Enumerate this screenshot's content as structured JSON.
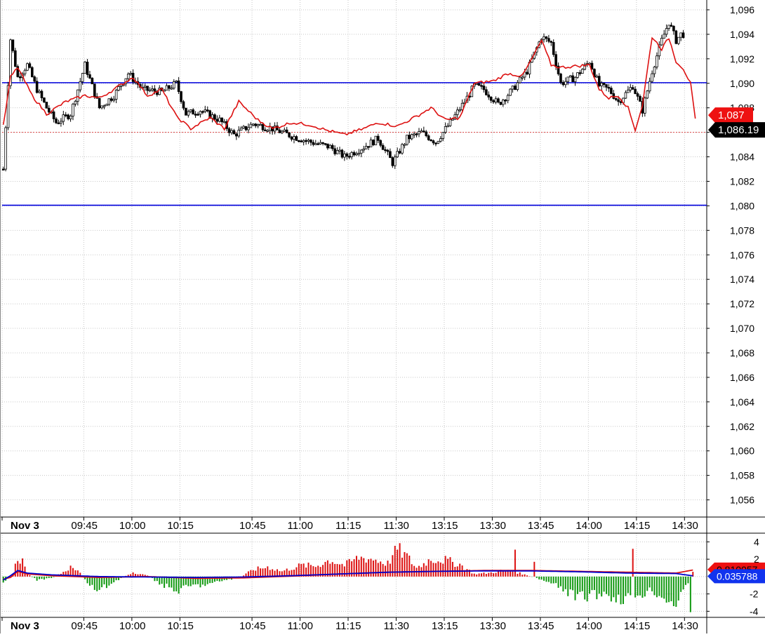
{
  "chart_data": [
    {
      "type": "candlestick",
      "panel": "price",
      "title": "",
      "y_axis_side": "right",
      "ylim": [
        1054.6,
        1096.8
      ],
      "y_ticks": [
        "1,096",
        "1,094",
        "1,092",
        "1,090",
        "1,088",
        "1,086",
        "1,084",
        "1,082",
        "1,080",
        "1,078",
        "1,076",
        "1,074",
        "1,072",
        "1,070",
        "1,068",
        "1,066",
        "1,064",
        "1,062",
        "1,060",
        "1,058",
        "1,056"
      ],
      "y_tick_values": [
        1096,
        1094,
        1092,
        1090,
        1088,
        1086,
        1084,
        1082,
        1080,
        1078,
        1076,
        1074,
        1072,
        1070,
        1068,
        1066,
        1064,
        1062,
        1060,
        1058,
        1056
      ],
      "x_ticks": [
        "Nov 3",
        "09:45",
        "10:00",
        "10:15",
        "10:45",
        "11:00",
        "11:15",
        "11:30",
        "13:15",
        "13:30",
        "13:45",
        "14:00",
        "14:15",
        "14:30"
      ],
      "x_tick_slots": [
        0,
        34,
        54,
        74,
        104,
        124,
        144,
        164,
        184,
        204,
        224,
        244,
        264,
        284
      ],
      "n_slots": 288,
      "grid": true,
      "horizontal_lines": [
        {
          "value": 1090.05,
          "color": "#0000dd"
        },
        {
          "value": 1080.05,
          "color": "#0000dd"
        },
        {
          "value": 1086.0,
          "color": "#dd4444",
          "style": "dotted"
        }
      ],
      "price_labels": [
        {
          "text": "1,087",
          "value": 1087.4,
          "bg": "#ee1111",
          "fg": "#ffffff"
        },
        {
          "text": "1,086.19",
          "value": 1086.2,
          "bg": "#000000",
          "fg": "#ffffff"
        }
      ],
      "close_anchors": [
        [
          0,
          1083
        ],
        [
          3,
          1093.6
        ],
        [
          6,
          1090.5
        ],
        [
          10,
          1091.5
        ],
        [
          14,
          1089.5
        ],
        [
          18,
          1088
        ],
        [
          22,
          1086.8
        ],
        [
          28,
          1087.5
        ],
        [
          34,
          1091.5
        ],
        [
          40,
          1088
        ],
        [
          46,
          1089
        ],
        [
          52,
          1090.8
        ],
        [
          58,
          1089.5
        ],
        [
          66,
          1089.3
        ],
        [
          72,
          1090
        ],
        [
          76,
          1087.5
        ],
        [
          82,
          1087.8
        ],
        [
          90,
          1087
        ],
        [
          96,
          1085.8
        ],
        [
          104,
          1086.7
        ],
        [
          112,
          1086.3
        ],
        [
          120,
          1085.7
        ],
        [
          128,
          1085.2
        ],
        [
          136,
          1084.8
        ],
        [
          142,
          1084
        ],
        [
          150,
          1084.8
        ],
        [
          156,
          1085.5
        ],
        [
          162,
          1083.5
        ],
        [
          168,
          1085.5
        ],
        [
          174,
          1086
        ],
        [
          180,
          1085.2
        ],
        [
          186,
          1086.8
        ],
        [
          192,
          1088.5
        ],
        [
          196,
          1089.8
        ],
        [
          200,
          1089.5
        ],
        [
          206,
          1088.3
        ],
        [
          212,
          1089.5
        ],
        [
          218,
          1091
        ],
        [
          224,
          1093.8
        ],
        [
          228,
          1093.3
        ],
        [
          232,
          1090
        ],
        [
          238,
          1090.5
        ],
        [
          244,
          1091.8
        ],
        [
          248,
          1089.8
        ],
        [
          252,
          1089.5
        ],
        [
          256,
          1088.5
        ],
        [
          262,
          1089.8
        ],
        [
          266,
          1087.8
        ],
        [
          270,
          1091
        ],
        [
          274,
          1093.5
        ],
        [
          277,
          1095
        ],
        [
          280,
          1093.5
        ],
        [
          282,
          1094
        ]
      ],
      "series": [
        {
          "name": "",
          "color": "#dd1111",
          "anchors": [
            [
              0,
              1086.5
            ],
            [
              3,
              1090.5
            ],
            [
              6,
              1091.3
            ],
            [
              12,
              1089
            ],
            [
              18,
              1087.5
            ],
            [
              26,
              1088.5
            ],
            [
              34,
              1089
            ],
            [
              40,
              1088.8
            ],
            [
              46,
              1089.5
            ],
            [
              54,
              1090.5
            ],
            [
              60,
              1089
            ],
            [
              66,
              1089.5
            ],
            [
              72,
              1087.3
            ],
            [
              78,
              1086.3
            ],
            [
              86,
              1087.2
            ],
            [
              92,
              1086.3
            ],
            [
              98,
              1088.5
            ],
            [
              106,
              1087
            ],
            [
              112,
              1086.3
            ],
            [
              120,
              1086.8
            ],
            [
              128,
              1086.6
            ],
            [
              134,
              1086.2
            ],
            [
              142,
              1085.8
            ],
            [
              150,
              1086.3
            ],
            [
              156,
              1086.8
            ],
            [
              164,
              1086.5
            ],
            [
              172,
              1087.3
            ],
            [
              178,
              1088
            ],
            [
              184,
              1087
            ],
            [
              190,
              1087.2
            ],
            [
              196,
              1090
            ],
            [
              204,
              1090.2
            ],
            [
              210,
              1090.8
            ],
            [
              216,
              1090.6
            ],
            [
              220,
              1092
            ],
            [
              224,
              1093.5
            ],
            [
              228,
              1091.5
            ],
            [
              232,
              1091.3
            ],
            [
              238,
              1091.4
            ],
            [
              244,
              1091.5
            ],
            [
              248,
              1089.5
            ],
            [
              252,
              1088.8
            ],
            [
              256,
              1089
            ],
            [
              260,
              1088
            ],
            [
              263,
              1086.2
            ],
            [
              266,
              1088.2
            ],
            [
              270,
              1093.8
            ],
            [
              274,
              1092.8
            ],
            [
              277,
              1093.7
            ],
            [
              280,
              1091.8
            ],
            [
              283,
              1091.2
            ],
            [
              286,
              1090
            ],
            [
              288,
              1087
            ]
          ]
        }
      ]
    },
    {
      "type": "bar",
      "panel": "oscillator",
      "title": "",
      "y_axis_side": "right",
      "ylim": [
        -4.7,
        5.0
      ],
      "y_ticks": [
        "4",
        "2",
        "-2",
        "-4"
      ],
      "y_tick_values": [
        4,
        2,
        -2,
        -4
      ],
      "x_ticks": [
        "Nov 3",
        "09:45",
        "10:00",
        "10:15",
        "10:45",
        "11:00",
        "11:15",
        "11:30",
        "13:15",
        "13:30",
        "13:45",
        "14:00",
        "14:15",
        "14:30"
      ],
      "x_tick_slots": [
        0,
        34,
        54,
        74,
        104,
        124,
        144,
        164,
        184,
        204,
        224,
        244,
        264,
        284
      ],
      "n_slots": 288,
      "positive_color": "#dd1111",
      "negative_color": "#119911",
      "bar_anchors": [
        [
          0,
          -0.6
        ],
        [
          4,
          0.3
        ],
        [
          6,
          2.2
        ],
        [
          8,
          1.8
        ],
        [
          10,
          0.3
        ],
        [
          14,
          -0.4
        ],
        [
          20,
          -0.2
        ],
        [
          28,
          1.0
        ],
        [
          32,
          0.5
        ],
        [
          36,
          -1.2
        ],
        [
          40,
          -1.6
        ],
        [
          46,
          -0.6
        ],
        [
          54,
          0.5
        ],
        [
          60,
          0.1
        ],
        [
          66,
          -0.9
        ],
        [
          72,
          -1.7
        ],
        [
          78,
          -1.1
        ],
        [
          86,
          -0.9
        ],
        [
          92,
          -0.4
        ],
        [
          98,
          -0.2
        ],
        [
          104,
          0.8
        ],
        [
          110,
          1.1
        ],
        [
          116,
          0.6
        ],
        [
          124,
          1.3
        ],
        [
          130,
          1.2
        ],
        [
          136,
          1.9
        ],
        [
          142,
          1.3
        ],
        [
          148,
          2.2
        ],
        [
          154,
          2.0
        ],
        [
          160,
          1.5
        ],
        [
          164,
          3.2
        ],
        [
          168,
          2.3
        ],
        [
          172,
          1.0
        ],
        [
          178,
          2.0
        ],
        [
          184,
          1.9
        ],
        [
          190,
          1.4
        ],
        [
          196,
          0.3
        ],
        [
          202,
          0.4
        ],
        [
          208,
          0.7
        ],
        [
          212,
          0.6
        ],
        [
          216,
          0.3
        ],
        [
          222,
          -0.2
        ],
        [
          228,
          -0.8
        ],
        [
          234,
          -1.6
        ],
        [
          238,
          -2.4
        ],
        [
          244,
          -2.2
        ],
        [
          250,
          -1.9
        ],
        [
          256,
          -2.6
        ],
        [
          262,
          -2.2
        ],
        [
          266,
          -2.0
        ],
        [
          270,
          -1.5
        ],
        [
          274,
          -2.4
        ],
        [
          278,
          -2.8
        ],
        [
          281,
          -3.2
        ],
        [
          284,
          -1.2
        ],
        [
          287,
          0.5
        ]
      ],
      "bar_overrides": [
        [
          213,
          3.1
        ],
        [
          221,
          1.7
        ],
        [
          262,
          3.2
        ],
        [
          286,
          -4.1
        ]
      ],
      "line_series": [
        {
          "name": "",
          "color": "#dd1111",
          "anchors": [
            [
              0,
              -0.3
            ],
            [
              3,
              -0.1
            ],
            [
              6,
              0.6
            ],
            [
              10,
              0.3
            ],
            [
              20,
              0.1
            ],
            [
              40,
              -0.1
            ],
            [
              60,
              0.0
            ],
            [
              80,
              -0.2
            ],
            [
              100,
              -0.15
            ],
            [
              120,
              0.05
            ],
            [
              140,
              0.3
            ],
            [
              160,
              0.5
            ],
            [
              180,
              0.6
            ],
            [
              200,
              0.7
            ],
            [
              220,
              0.7
            ],
            [
              240,
              0.6
            ],
            [
              260,
              0.5
            ],
            [
              280,
              0.4
            ],
            [
              288,
              0.81
            ]
          ]
        },
        {
          "name": "",
          "color": "#0000cc",
          "anchors": [
            [
              0,
              -0.4
            ],
            [
              3,
              0.1
            ],
            [
              6,
              0.7
            ],
            [
              10,
              0.4
            ],
            [
              20,
              0.2
            ],
            [
              40,
              0.0
            ],
            [
              60,
              -0.05
            ],
            [
              80,
              -0.1
            ],
            [
              100,
              -0.05
            ],
            [
              120,
              0.1
            ],
            [
              140,
              0.3
            ],
            [
              160,
              0.5
            ],
            [
              180,
              0.6
            ],
            [
              200,
              0.65
            ],
            [
              220,
              0.65
            ],
            [
              240,
              0.55
            ],
            [
              260,
              0.4
            ],
            [
              280,
              0.35
            ],
            [
              288,
              0.04
            ]
          ]
        }
      ],
      "price_labels": [
        {
          "text": "0.810057",
          "value": 0.81,
          "bg": "#ee1111",
          "fg": "#000000"
        },
        {
          "text": "0.035788",
          "value": 0.04,
          "bg": "#1133ee",
          "fg": "#ffffff"
        }
      ]
    }
  ]
}
